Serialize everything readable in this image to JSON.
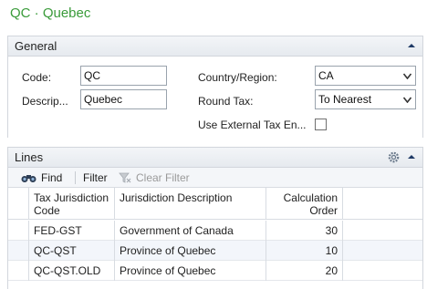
{
  "page": {
    "title": "QC · Quebec"
  },
  "general": {
    "title": "General",
    "code_label": "Code:",
    "code_value": "QC",
    "description_label": "Descrip...",
    "description_value": "Quebec",
    "country_label": "Country/Region:",
    "country_value": "CA",
    "round_tax_label": "Round Tax:",
    "round_tax_value": "To Nearest",
    "external_tax_label": "Use External Tax En...",
    "external_tax_checked": false
  },
  "lines": {
    "title": "Lines",
    "toolbar": {
      "find": "Find",
      "filter": "Filter",
      "clear_filter": "Clear Filter"
    },
    "columns": {
      "tax_jurisdiction_code": "Tax Jurisdiction Code",
      "jurisdiction_description": "Jurisdiction Description",
      "calculation_order": "Calculation Order"
    },
    "rows": [
      {
        "code": "FED-GST",
        "description": "Government of Canada",
        "order": "30"
      },
      {
        "code": "QC-QST",
        "description": "Province of Quebec",
        "order": "10"
      },
      {
        "code": "QC-QST.OLD",
        "description": "Province of Quebec",
        "order": "20"
      }
    ]
  },
  "icons": {
    "general_chevron": "chevron-up-icon",
    "lines_chevron": "chevron-up-icon",
    "lines_settings": "gear-icon",
    "find": "binoculars-icon",
    "clear_filter": "funnel-x-icon",
    "select_caret": "caret-down-icon"
  },
  "colors": {
    "title_green": "#3a9b3a",
    "header_bg": "#e6eaef",
    "alt_row": "#f3f6fb"
  }
}
